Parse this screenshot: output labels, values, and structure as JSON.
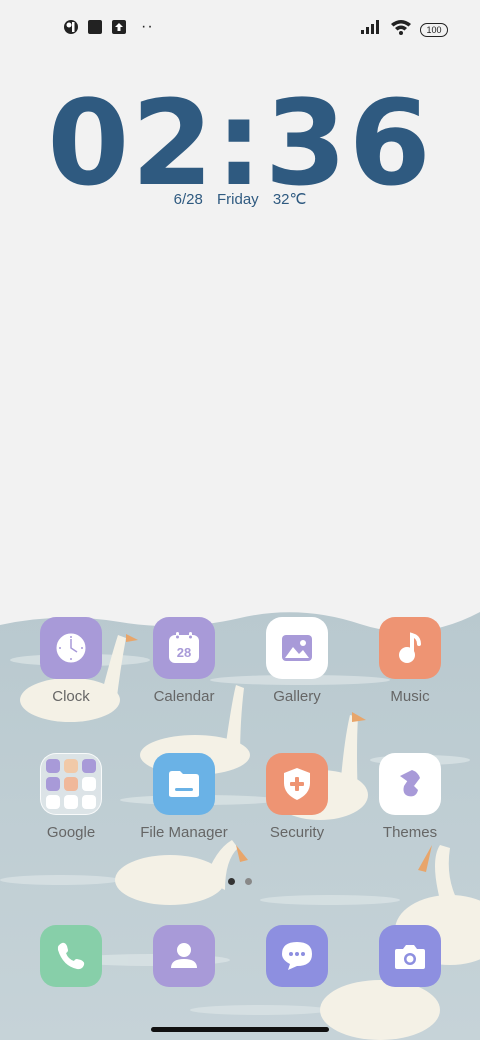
{
  "status_bar": {
    "icons_left": [
      "assistant-icon",
      "square-notification-icon",
      "upload-icon"
    ],
    "more_dots": "··",
    "signal": "signal-icon",
    "wifi": "wifi-icon",
    "battery_level": "100"
  },
  "clock": {
    "time": "02:36",
    "date": "6/28",
    "weekday": "Friday",
    "temperature": "32℃"
  },
  "apps": [
    {
      "label": "Clock",
      "icon": "clock-icon",
      "color": "#a89ad8"
    },
    {
      "label": "Calendar",
      "icon": "calendar-icon",
      "color": "#a89ad8",
      "badge": "28"
    },
    {
      "label": "Gallery",
      "icon": "gallery-icon",
      "color": "#ffffff"
    },
    {
      "label": "Music",
      "icon": "music-icon",
      "color": "#ee9473"
    },
    {
      "label": "Google",
      "icon": "folder-icon",
      "color": "#ffffff"
    },
    {
      "label": "File Manager",
      "icon": "folder-icon",
      "color": "#6ab2e6"
    },
    {
      "label": "Security",
      "icon": "shield-icon",
      "color": "#ee9473"
    },
    {
      "label": "Themes",
      "icon": "brush-icon",
      "color": "#ffffff"
    }
  ],
  "dock": [
    {
      "icon": "phone-icon",
      "color": "#87cfa9"
    },
    {
      "icon": "contacts-icon",
      "color": "#a89ad8"
    },
    {
      "icon": "messages-icon",
      "color": "#8d8fe0"
    },
    {
      "icon": "camera-icon",
      "color": "#8d8fe0"
    }
  ],
  "pages": {
    "count": 2,
    "current": 1
  }
}
